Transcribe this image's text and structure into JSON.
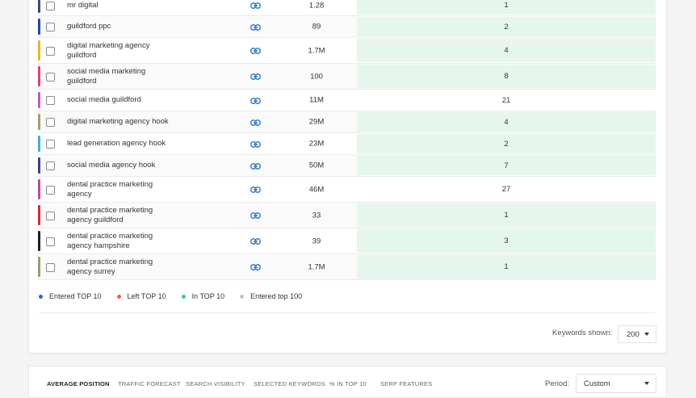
{
  "rows": [
    {
      "keyword": "mr digital",
      "volume": "1.28",
      "position": "1",
      "highlight": true,
      "color": "#3c4b7e"
    },
    {
      "keyword": "guildford ppc",
      "volume": "89",
      "position": "2",
      "highlight": true,
      "color": "#2948a8"
    },
    {
      "keyword": "digital marketing agency guildford",
      "volume": "1.7M",
      "position": "4",
      "highlight": true,
      "color": "#e5b92a"
    },
    {
      "keyword": "social media marketing guildford",
      "volume": "100",
      "position": "8",
      "highlight": true,
      "color": "#e0427a"
    },
    {
      "keyword": "social media guildford",
      "volume": "11M",
      "position": "21",
      "highlight": false,
      "color": "#c05ac9"
    },
    {
      "keyword": "digital marketing agency hook",
      "volume": "29M",
      "position": "4",
      "highlight": true,
      "color": "#a6a06c"
    },
    {
      "keyword": "lead generation agency hook",
      "volume": "23M",
      "position": "2",
      "highlight": true,
      "color": "#3db0e8"
    },
    {
      "keyword": "social media agency hook",
      "volume": "50M",
      "position": "7",
      "highlight": true,
      "color": "#3e3e8f"
    },
    {
      "keyword": "dental practice marketing agency",
      "volume": "46M",
      "position": "27",
      "highlight": false,
      "color": "#c24aa0"
    },
    {
      "keyword": "dental practice marketing agency guildford",
      "volume": "33",
      "position": "1",
      "highlight": true,
      "color": "#d9283c"
    },
    {
      "keyword": "dental practice marketing agency hampshire",
      "volume": "39",
      "position": "3",
      "highlight": true,
      "color": "#1f1f2e"
    },
    {
      "keyword": "dental practice marketing agency surrey",
      "volume": "1.7M",
      "position": "1",
      "highlight": true,
      "color": "#9aa06a"
    }
  ],
  "legend": [
    {
      "label": "Entered TOP 10",
      "color": "#2a66c9"
    },
    {
      "label": "Left TOP 10",
      "color": "#ef5a5a"
    },
    {
      "label": "In TOP 10",
      "color": "#3cc98a"
    },
    {
      "label": "Entered top 100",
      "color": "#c4c4c4"
    }
  ],
  "keywords_shown": {
    "label": "Keywords shown:",
    "value": "200"
  },
  "tabs": [
    {
      "label": "AVERAGE POSITION",
      "active": true
    },
    {
      "label": "TRAFFIC FORECAST",
      "active": false
    },
    {
      "label": "SEARCH VISIBILITY",
      "active": false
    },
    {
      "label": "SELECTED KEYWORDS",
      "active": false
    },
    {
      "label": "% IN TOP 10",
      "active": false
    },
    {
      "label": "SERP FEATURES",
      "active": false
    }
  ],
  "period": {
    "label": "Period:",
    "value": "Custom"
  },
  "icons": {
    "link": "link-icon",
    "checkbox": "checkbox",
    "dropdown": "chevron-down-icon"
  }
}
